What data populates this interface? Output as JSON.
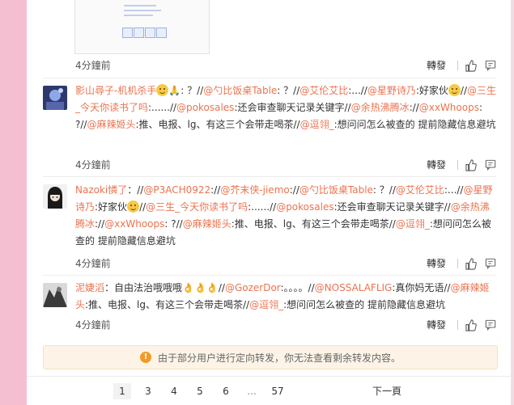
{
  "post": {
    "time": "4分鐘前",
    "repost_label": "轉發"
  },
  "comments": [
    {
      "user": "影山尋子-机机杀手",
      "parts": [
        ": ？//",
        "@勺比饭桌Table",
        ": ？//",
        "@艾伦艾比",
        ":...//",
        "@星野诗乃",
        ":好家伙",
        "//",
        "@三生_今天你读书了吗",
        ":......//",
        "@pokosales",
        ":还会审查聊天记录关键字//",
        "@余热沸腾冰",
        ":",
        "//",
        "@xxWhoops",
        ": ?//",
        "@麻辣姬头",
        ":推、电报、lg、有这三个会带走喝茶//",
        "@逗翎_",
        ":想问问怎么被查的 提前隐藏信息避坑"
      ],
      "time": "4分鐘前",
      "repost_label": "轉發"
    },
    {
      "user": "Nazoki憐了",
      "parts": [
        "：//",
        "@P3ACH0922",
        "://",
        "@芥末侠-jiemo",
        "://",
        "@勺比饭桌Table",
        ": ？//",
        "@艾伦艾比",
        ":...//",
        "@星野诗乃",
        ":好家伙",
        "//",
        "@三生_今天你读书了吗",
        ":......//",
        "@pokosales",
        ":还会审查聊天记录关键字//",
        "@余热沸腾冰",
        "://",
        "@xxWhoops",
        ": ?//",
        "@麻辣姬头",
        ":推、电报、lg、有这三个会带走喝茶//",
        "@逗翎_",
        ":想问问怎么被查的 提前隐藏信息避坑"
      ],
      "time": "4分鐘前",
      "repost_label": "轉發"
    },
    {
      "user": "泥婕滔",
      "parts": [
        "：自由法治哦哦哦",
        "//",
        "@GozerDor",
        ":。。。。//",
        "@NOSSALAFLIG",
        ":真你妈无语//",
        "@麻辣姬头",
        ":推、电报、lg、有这三个会带走喝茶//",
        "@逗翎_",
        ":想问问怎么被查的 提前隐藏信息避坑"
      ],
      "time": "4分鐘前",
      "repost_label": "轉發"
    }
  ],
  "notice": {
    "text": "由于部分用户进行定向转发，你无法查看剩余转发内容。"
  },
  "pagination": {
    "pages": [
      "1",
      "3",
      "4",
      "5",
      "6",
      "...",
      "57"
    ],
    "active": "1",
    "next_label": "下一頁"
  },
  "icons": {
    "like": "thumbs-up-icon",
    "reply": "comment-icon",
    "notice": "warning-icon"
  },
  "colors": {
    "username": "#eb7350",
    "mention": "#eb7350",
    "notice_bg": "#fdf4e7",
    "notice_icon": "#f29a28"
  }
}
